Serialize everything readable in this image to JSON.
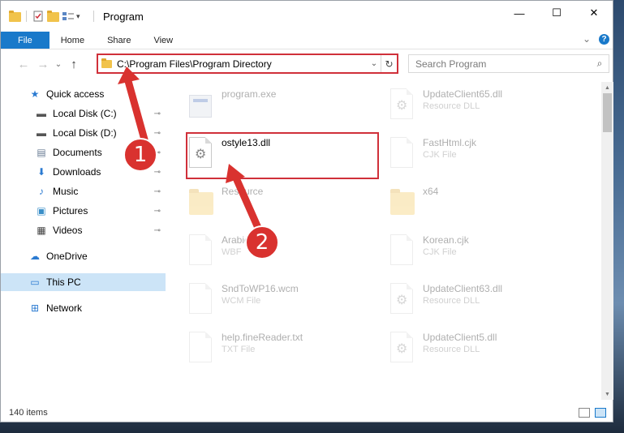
{
  "window": {
    "title": "Program",
    "minimize": "—",
    "maximize": "☐",
    "close": "✕"
  },
  "ribbon": {
    "tabs": [
      {
        "label": "File"
      },
      {
        "label": "Home"
      },
      {
        "label": "Share"
      },
      {
        "label": "View"
      }
    ],
    "expand": "⌄",
    "help": "?"
  },
  "nav": {
    "back": "←",
    "forward": "→",
    "recent": "⌄",
    "up": "↑"
  },
  "address": {
    "path": "C:\\Program Files\\Program Directory",
    "dropdown": "⌄",
    "refresh": "↻"
  },
  "search": {
    "placeholder": "Search Program"
  },
  "sidebar": {
    "items": [
      {
        "label": "Quick access",
        "icon": "star-icon",
        "glyph": "★",
        "color": "#2a7ad1"
      },
      {
        "label": "Local Disk (C:)",
        "icon": "drive-icon",
        "glyph": "▬",
        "color": "#555555",
        "pinned": true
      },
      {
        "label": "Local Disk (D:)",
        "icon": "drive-icon",
        "glyph": "▬",
        "color": "#555555",
        "pinned": true
      },
      {
        "label": "Documents",
        "icon": "document-icon",
        "glyph": "▤",
        "color": "#6a7c94",
        "pinned": true
      },
      {
        "label": "Downloads",
        "icon": "download-icon",
        "glyph": "⬇",
        "color": "#2a7ad1",
        "pinned": true
      },
      {
        "label": "Music",
        "icon": "music-icon",
        "glyph": "♪",
        "color": "#2a7ad1",
        "pinned": true
      },
      {
        "label": "Pictures",
        "icon": "picture-icon",
        "glyph": "▣",
        "color": "#3a8fc8",
        "pinned": true
      },
      {
        "label": "Videos",
        "icon": "video-icon",
        "glyph": "▦",
        "color": "#444444",
        "pinned": true
      },
      {
        "label": "OneDrive",
        "icon": "cloud-icon",
        "glyph": "☁",
        "color": "#2a7ad1"
      },
      {
        "label": "This PC",
        "icon": "computer-icon",
        "glyph": "▭",
        "color": "#2a7ad1",
        "selected": true
      },
      {
        "label": "Network",
        "icon": "network-icon",
        "glyph": "⊞",
        "color": "#2a7ad1"
      }
    ],
    "pin_glyph": "📌"
  },
  "files": [
    {
      "name": "program.exe",
      "type": "",
      "kind": "exe"
    },
    {
      "name": "UpdateClient65.dll",
      "type": "Resource DLL",
      "kind": "dll"
    },
    {
      "name": "ostyle13.dll",
      "type": "",
      "kind": "dll",
      "highlighted": true
    },
    {
      "name": "FastHtml.cjk",
      "type": "CJK File",
      "kind": "doc"
    },
    {
      "name": "Resource",
      "type": "",
      "kind": "folder"
    },
    {
      "name": "x64",
      "type": "",
      "kind": "folder"
    },
    {
      "name": "Arabic",
      "type": "WBF",
      "kind": "doc"
    },
    {
      "name": "Korean.cjk",
      "type": "CJK File",
      "kind": "doc"
    },
    {
      "name": "SndToWP16.wcm",
      "type": "WCM File",
      "kind": "doc"
    },
    {
      "name": "UpdateClient63.dll",
      "type": "Resource DLL",
      "kind": "dll"
    },
    {
      "name": "help.fineReader.txt",
      "type": "TXT File",
      "kind": "doc"
    },
    {
      "name": "UpdateClient5.dll",
      "type": "Resource DLL",
      "kind": "dll"
    }
  ],
  "annotations": {
    "step1": "1",
    "step2": "2",
    "color": "#d9322f"
  },
  "status": {
    "items_count": "140 items"
  }
}
